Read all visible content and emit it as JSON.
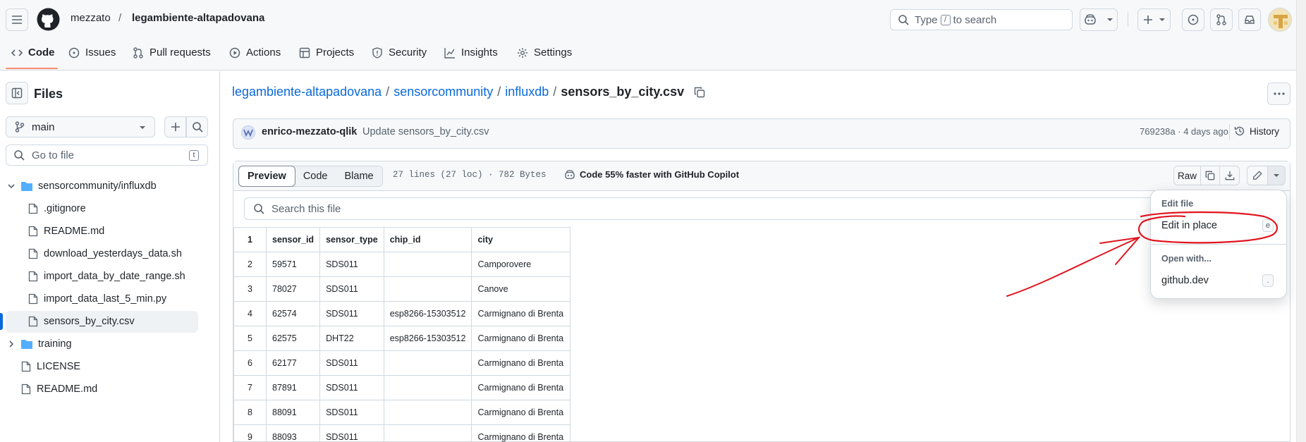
{
  "header": {
    "owner": "mezzato",
    "separator": "/",
    "repo": "legambiente-altapadovana",
    "search_label": "Type",
    "search_key": "/",
    "search_suffix": "to search"
  },
  "nav": {
    "items": [
      {
        "label": "Code",
        "icon": "code-icon",
        "active": true
      },
      {
        "label": "Issues",
        "icon": "issue-icon"
      },
      {
        "label": "Pull requests",
        "icon": "pull-request-icon"
      },
      {
        "label": "Actions",
        "icon": "play-icon"
      },
      {
        "label": "Projects",
        "icon": "table-icon"
      },
      {
        "label": "Security",
        "icon": "shield-icon"
      },
      {
        "label": "Insights",
        "icon": "graph-icon"
      },
      {
        "label": "Settings",
        "icon": "gear-icon"
      }
    ]
  },
  "sidebar": {
    "title": "Files",
    "branch": "main",
    "goto_placeholder": "Go to file",
    "goto_key": "t",
    "tree": [
      {
        "label": "sensorcommunity/influxdb",
        "type": "folder",
        "expanded": true
      },
      {
        "label": ".gitignore",
        "type": "file"
      },
      {
        "label": "README.md",
        "type": "file"
      },
      {
        "label": "download_yesterdays_data.sh",
        "type": "file"
      },
      {
        "label": "import_data_by_date_range.sh",
        "type": "file"
      },
      {
        "label": "import_data_last_5_min.py",
        "type": "file"
      },
      {
        "label": "sensors_by_city.csv",
        "type": "file",
        "selected": true
      },
      {
        "label": "training",
        "type": "folder",
        "expanded": false
      },
      {
        "label": "LICENSE",
        "type": "file"
      },
      {
        "label": "README.md",
        "type": "file"
      }
    ]
  },
  "path": {
    "repo": "legambiente-altapadovana",
    "dir1": "sensorcommunity",
    "dir2": "influxdb",
    "file": "sensors_by_city.csv",
    "sep": "/"
  },
  "commit": {
    "author": "enrico-mezzato-qlik",
    "message": "Update sensors_by_city.csv",
    "hash": "769238a",
    "dot": "·",
    "age": "4 days ago",
    "history_label": "History"
  },
  "file_header": {
    "tabs": [
      "Preview",
      "Code",
      "Blame"
    ],
    "info": "27 lines (27 loc) · 782 Bytes",
    "copilot": "Code 55% faster with GitHub Copilot",
    "raw_label": "Raw"
  },
  "file_search_placeholder": "Search this file",
  "csv": {
    "header_row": "1",
    "columns": [
      "sensor_id",
      "sensor_type",
      "chip_id",
      "city"
    ],
    "rows": [
      {
        "n": "2",
        "cells": [
          "59571",
          "SDS011",
          "",
          "Camporovere"
        ]
      },
      {
        "n": "3",
        "cells": [
          "78027",
          "SDS011",
          "",
          "Canove"
        ]
      },
      {
        "n": "4",
        "cells": [
          "62574",
          "SDS011",
          "esp8266-15303512",
          "Carmignano di Brenta"
        ]
      },
      {
        "n": "5",
        "cells": [
          "62575",
          "DHT22",
          "esp8266-15303512",
          "Carmignano di Brenta"
        ]
      },
      {
        "n": "6",
        "cells": [
          "62177",
          "SDS011",
          "",
          "Carmignano di Brenta"
        ]
      },
      {
        "n": "7",
        "cells": [
          "87891",
          "SDS011",
          "",
          "Carmignano di Brenta"
        ]
      },
      {
        "n": "8",
        "cells": [
          "88091",
          "SDS011",
          "",
          "Carmignano di Brenta"
        ]
      },
      {
        "n": "9",
        "cells": [
          "88093",
          "SDS011",
          "",
          "Carmignano di Brenta"
        ]
      }
    ]
  },
  "dropdown": {
    "group1": "Edit file",
    "item1": "Edit in place",
    "item1_key": "e",
    "group2": "Open with...",
    "item2": "github.dev",
    "item2_key": "."
  },
  "colors": {
    "accent": "#0969da",
    "tab_underline": "#fd8c73",
    "annotation": "#e0141e"
  }
}
